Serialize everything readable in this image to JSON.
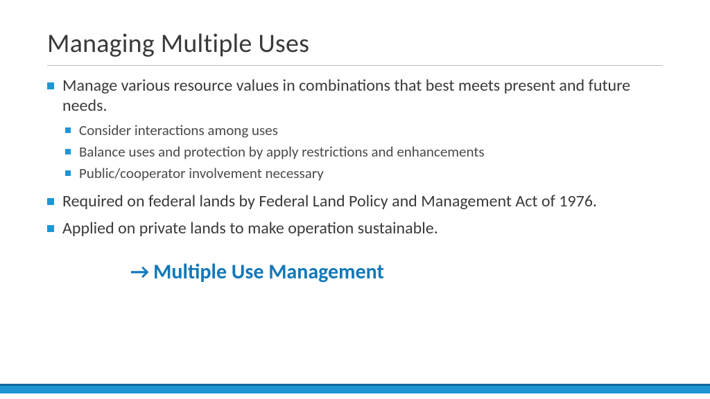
{
  "title": "Managing Multiple Uses",
  "bullets": {
    "b1": "Manage various resource values in combinations that best meets present and future needs.",
    "b1_sub": {
      "s1": "Consider interactions among uses",
      "s2": "Balance uses and protection by apply restrictions and enhancements",
      "s3": "Public/cooperator involvement necessary"
    },
    "b2": "Required on federal lands by Federal Land Policy and Management Act of 1976.",
    "b3": "Applied on private lands to make operation sustainable."
  },
  "callout": {
    "arrow": "→",
    "text": "Multiple Use Management"
  }
}
